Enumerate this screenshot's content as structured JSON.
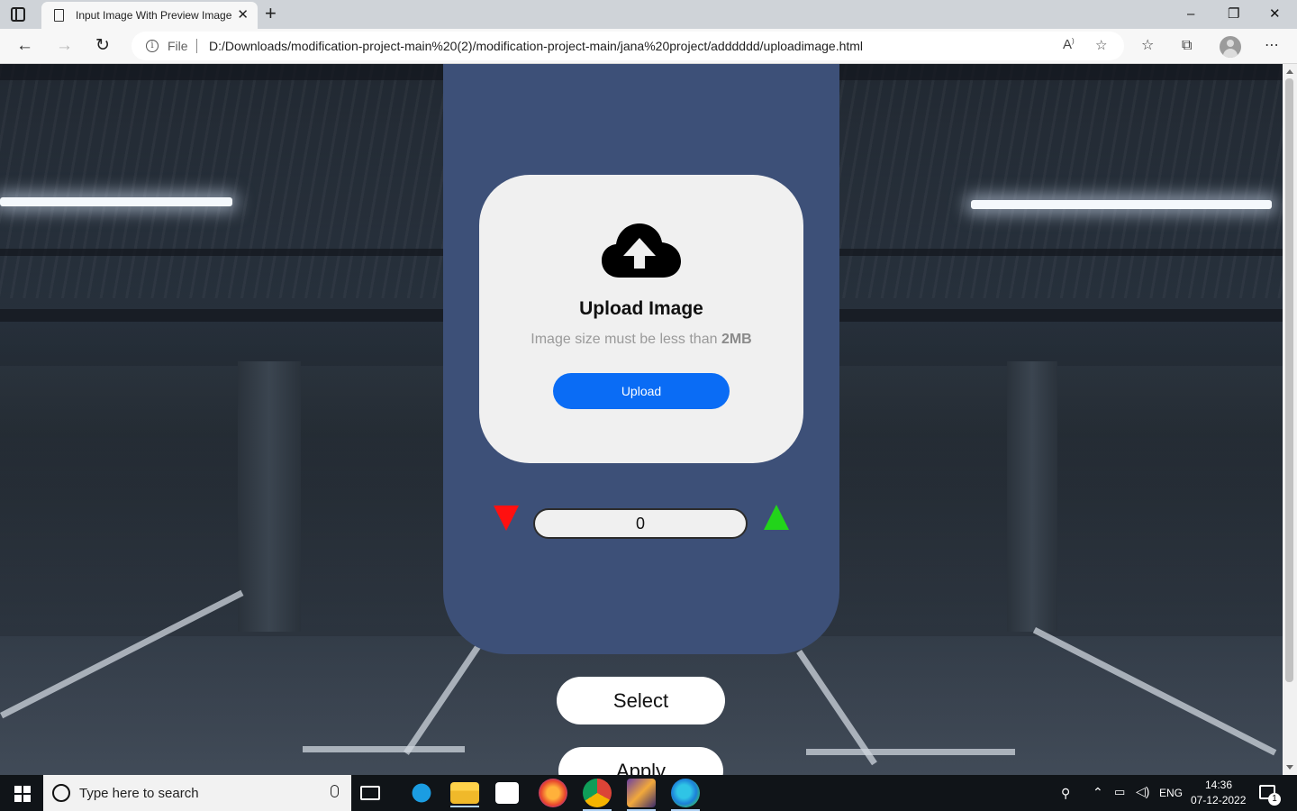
{
  "browser": {
    "tab_title": "Input Image With Preview Image",
    "tab_close": "✕",
    "new_tab": "+",
    "address_scheme": "File",
    "url": "D:/Downloads/modification-project-main%20(2)/modification-project-main/jana%20project/adddddd/uploadimage.html",
    "window_controls": [
      "–",
      "❐",
      "✕"
    ],
    "nav": {
      "back": "←",
      "forward": "→",
      "refresh": "↻"
    }
  },
  "upload_card": {
    "title": "Upload Image",
    "subtitle_prefix": "Image size must be less than ",
    "subtitle_limit": "2MB",
    "upload_button": "Upload",
    "icon": "cloud-upload-icon"
  },
  "counter": {
    "value": "0",
    "decrement_icon": "red-down-triangle",
    "increment_icon": "green-up-triangle"
  },
  "actions": {
    "select_label": "Select",
    "apply_label": "Apply"
  },
  "colors": {
    "card_bg": "#3d5078",
    "upload_box_bg": "#f0f0f0",
    "upload_button": "#0a6cf5",
    "decrement": "#ff1010",
    "increment": "#22d41a"
  },
  "taskbar": {
    "search_placeholder": "Type here to search",
    "language": "ENG",
    "time": "14:36",
    "date": "07-12-2022",
    "notification_count": "1",
    "apps": [
      "task-view",
      "internet-explorer",
      "file-explorer",
      "microsoft-store",
      "firefox",
      "chrome",
      "game-app",
      "edge"
    ]
  }
}
